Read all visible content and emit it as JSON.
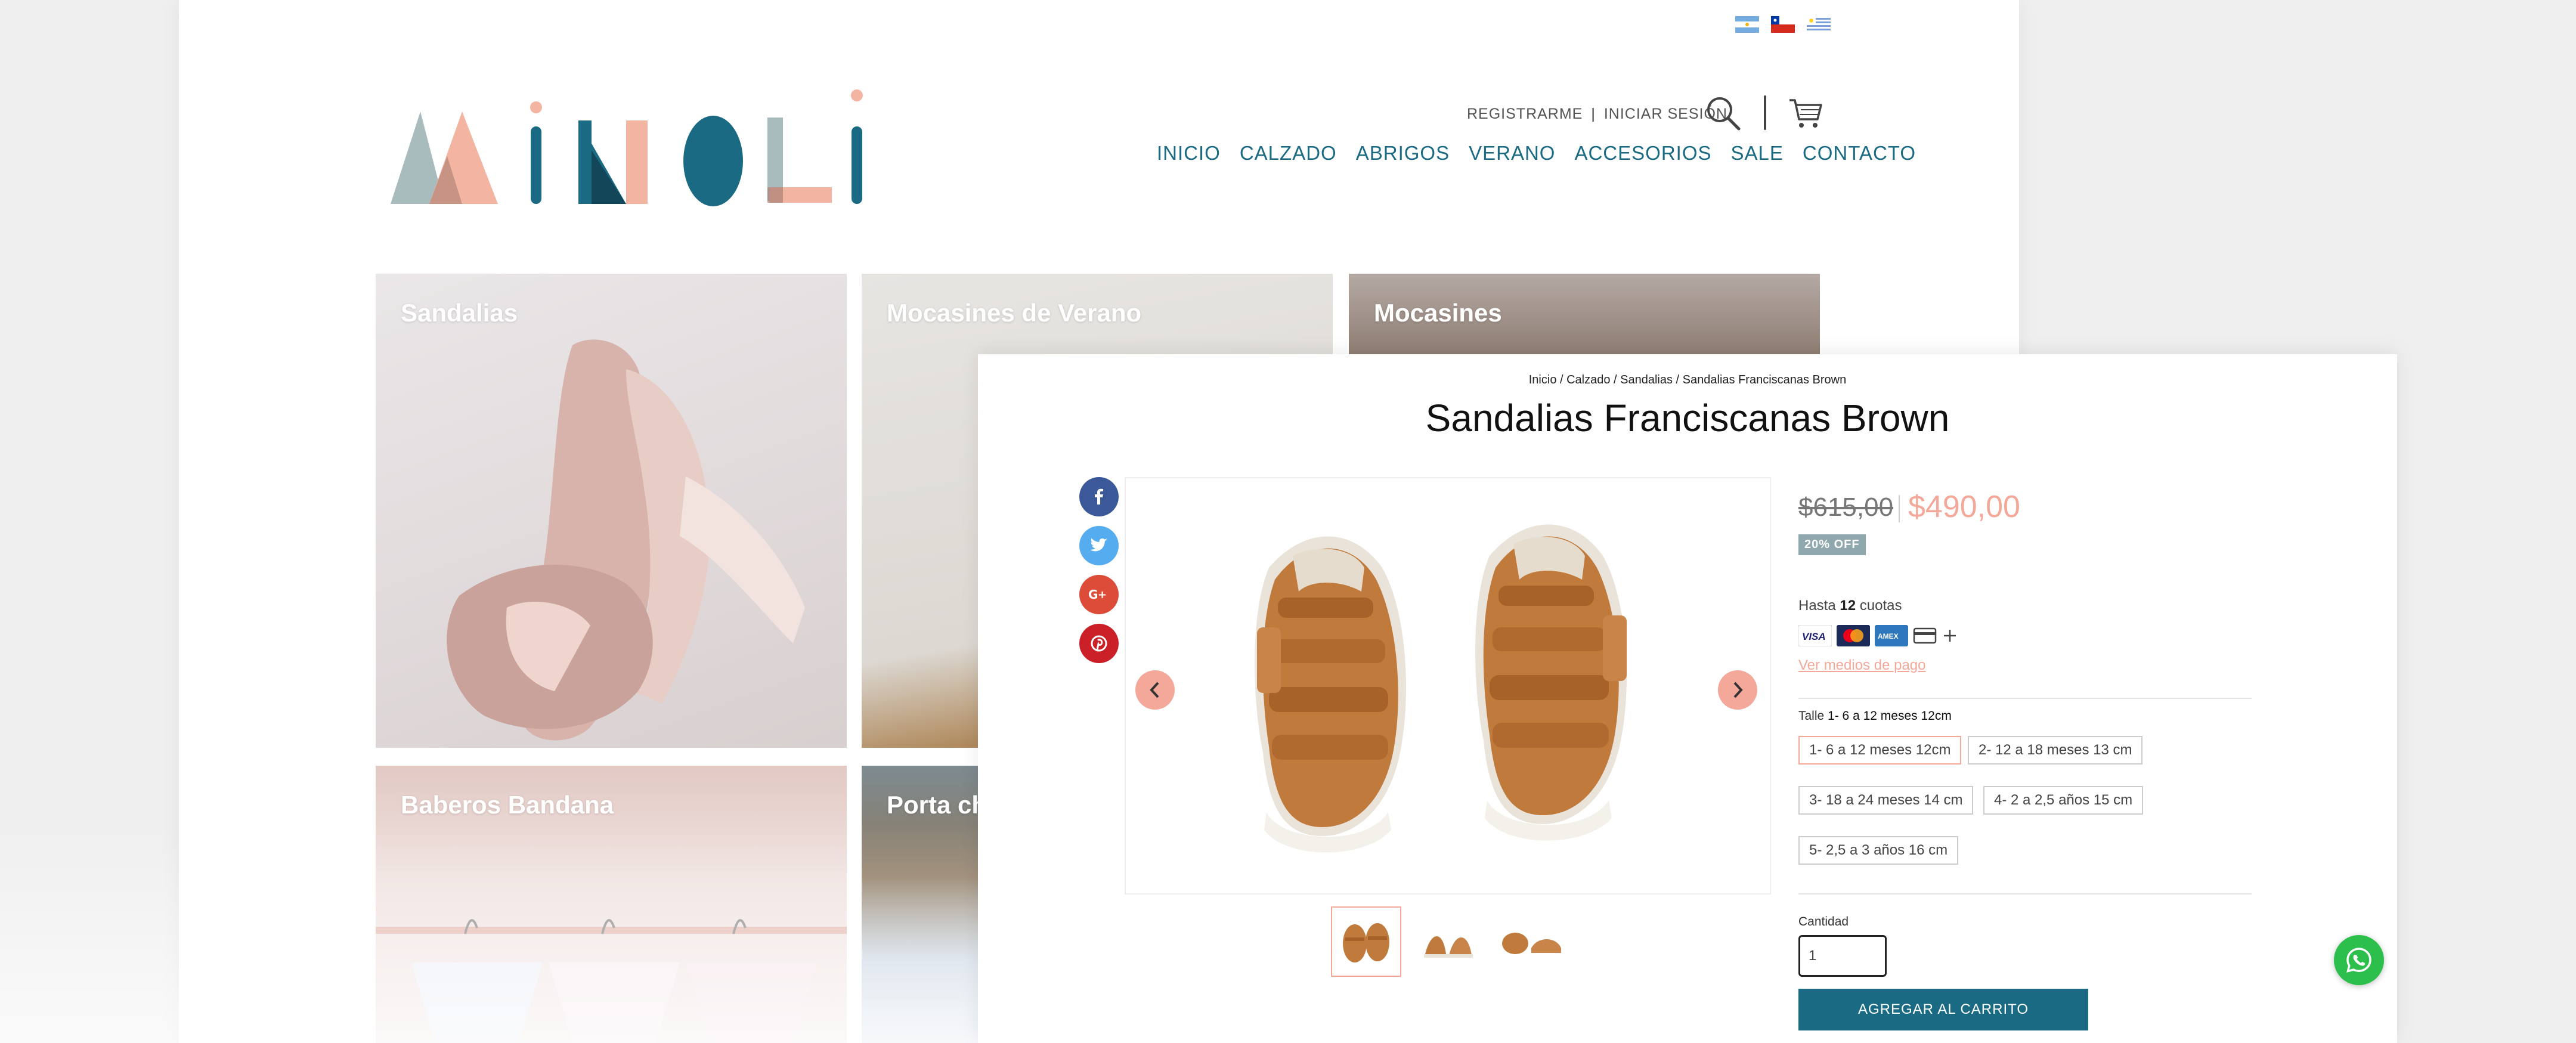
{
  "flags": [
    "argentina-flag-icon",
    "chile-flag-icon",
    "uruguay-flag-icon"
  ],
  "brand": {
    "logo_text": "MINOLI"
  },
  "account": {
    "register": "REGISTRARME",
    "separator": "|",
    "login": "INICIAR SESIÓN"
  },
  "nav": [
    "INICIO",
    "CALZADO",
    "ABRIGOS",
    "VERANO",
    "ACCESORIOS",
    "SALE",
    "CONTACTO"
  ],
  "categories": [
    {
      "title": "Sandalias"
    },
    {
      "title": "Mocasines de Verano"
    },
    {
      "title": "Mocasines"
    },
    {
      "title": "Baberos Bandana"
    },
    {
      "title": "Porta ch"
    }
  ],
  "product": {
    "breadcrumb": "Inicio / Calzado / Sandalias / Sandalias Franciscanas Brown",
    "title": "Sandalias Franciscanas Brown",
    "old_price": "$615,00",
    "price": "$490,00",
    "discount_badge": "20% OFF",
    "installments_prefix": "Hasta",
    "installments_count": "12",
    "installments_suffix": "cuotas",
    "payment_icons": [
      "visa-icon",
      "mastercard-icon",
      "amex-icon",
      "credit-card-icon",
      "plus-icon"
    ],
    "visa_label": "VISA",
    "amex_label": "AMEX",
    "payment_link": "Ver medios de pago",
    "size_label": "Talle",
    "selected_size": "1- 6 a 12 meses 12cm",
    "sizes": [
      "1- 6 a 12 meses 12cm",
      "2- 12 a 18 meses 13 cm",
      "3- 18 a 24 meses 14 cm",
      "4- 2 a 2,5 años 15 cm",
      "5- 2,5 a 3 años 16 cm"
    ],
    "quantity_label": "Cantidad",
    "quantity": "1",
    "add_to_cart": "AGREGAR AL CARRITO",
    "share": [
      "facebook-icon",
      "twitter-icon",
      "google-plus-icon",
      "pinterest-icon"
    ],
    "thumbnails": 3
  },
  "colors": {
    "brand_teal": "#1a6a83",
    "accent_salmon": "#f3a89a",
    "badge_grey": "#8fa8ad",
    "whatsapp_green": "#2dbf4b"
  }
}
